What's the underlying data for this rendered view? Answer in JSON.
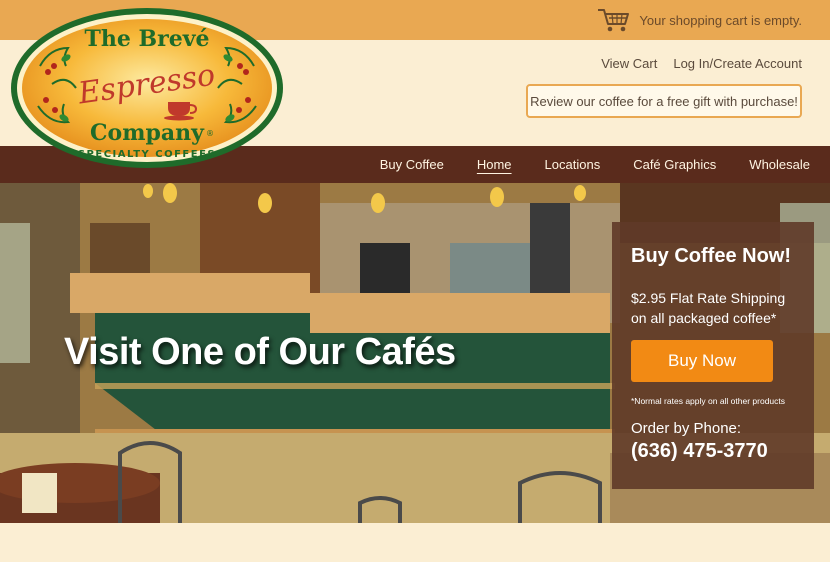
{
  "cart": {
    "icon": "shopping-cart-icon",
    "status_text": "Your shopping cart is empty."
  },
  "logo": {
    "line1": "The Brevé",
    "line2": "Espresso",
    "line3": "Company",
    "line4": "SPECIALTY COFFEES",
    "registered": "®"
  },
  "top_links": {
    "view_cart": "View Cart",
    "login": "Log In/Create Account"
  },
  "review_button": "Review our coffee for a free gift with purchase!",
  "nav": {
    "items": [
      {
        "label": "Buy Coffee"
      },
      {
        "label": "Home",
        "active": true
      },
      {
        "label": "Locations"
      },
      {
        "label": "Café Graphics"
      },
      {
        "label": "Wholesale"
      }
    ]
  },
  "hero": {
    "title": "Visit One of Our Cafés"
  },
  "promo": {
    "title": "Buy Coffee Now!",
    "shipping": "$2.95 Flat Rate Shipping on all packaged coffee*",
    "button": "Buy Now",
    "note": "*Normal rates apply on all other products",
    "phone_label": "Order by Phone:",
    "phone": "(636) 475-3770"
  },
  "colors": {
    "topbar": "#e9a852",
    "nav": "#5a2b1c",
    "cream": "#fbeed3",
    "accent_orange": "#f28a14",
    "logo_green": "#1f6b2a"
  }
}
